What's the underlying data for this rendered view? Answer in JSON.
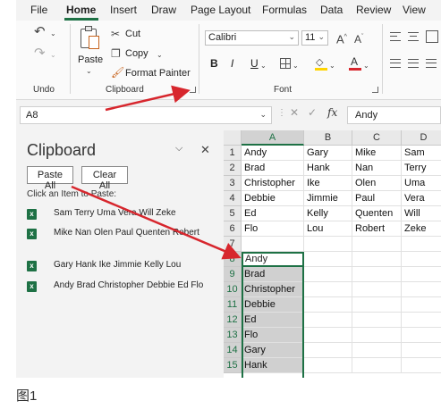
{
  "menu": [
    "File",
    "Home",
    "Insert",
    "Draw",
    "Page Layout",
    "Formulas",
    "Data",
    "Review",
    "View"
  ],
  "ribbon": {
    "undo_label": "Undo",
    "paste_label": "Paste",
    "cut_label": "Cut",
    "copy_label": "Copy",
    "format_painter_label": "Format Painter",
    "clipboard_label": "Clipboard",
    "font_name": "Calibri",
    "font_size": "11",
    "bold": "B",
    "italic": "I",
    "underline": "U",
    "font_label": "Font"
  },
  "formula_bar": {
    "name_box": "A8",
    "fx": "fx",
    "content": "Andy"
  },
  "clipboard_pane": {
    "title": "Clipboard",
    "paste_all": "Paste All",
    "clear_all": "Clear All",
    "hint": "Click an Item to Paste:",
    "items": [
      "Sam Terry Uma Vera Will Zeke",
      "Mike Nan Olen Paul Quenten Robert",
      "Gary Hank Ike Jimmie Kelly Lou",
      "Andy Brad Christopher Debbie Ed Flo"
    ]
  },
  "sheet": {
    "columns": [
      "A",
      "B",
      "C",
      "D"
    ],
    "rows": [
      "1",
      "2",
      "3",
      "4",
      "5",
      "6",
      "7",
      "8",
      "9",
      "10",
      "11",
      "12",
      "13",
      "14",
      "15"
    ],
    "cells": [
      [
        "Andy",
        "Gary",
        "Mike",
        "Sam"
      ],
      [
        "Brad",
        "Hank",
        "Nan",
        "Terry"
      ],
      [
        "Christopher",
        "Ike",
        "Olen",
        "Uma"
      ],
      [
        "Debbie",
        "Jimmie",
        "Paul",
        "Vera"
      ],
      [
        "Ed",
        "Kelly",
        "Quenten",
        "Will"
      ],
      [
        "Flo",
        "Lou",
        "Robert",
        "Zeke"
      ],
      [
        "",
        "",
        "",
        ""
      ],
      [
        "Andy",
        "",
        "",
        ""
      ],
      [
        "Brad",
        "",
        "",
        ""
      ],
      [
        "Christopher",
        "",
        "",
        ""
      ],
      [
        "Debbie",
        "",
        "",
        ""
      ],
      [
        "Ed",
        "",
        "",
        ""
      ],
      [
        "Flo",
        "",
        "",
        ""
      ],
      [
        "Gary",
        "",
        "",
        ""
      ],
      [
        "Hank",
        "",
        "",
        ""
      ]
    ],
    "active_cell": "A8"
  },
  "caption": "图1",
  "colors": {
    "excel_green": "#1e7145",
    "arrow_red": "#d7262d",
    "selection_gray": "#d0d0d0"
  }
}
